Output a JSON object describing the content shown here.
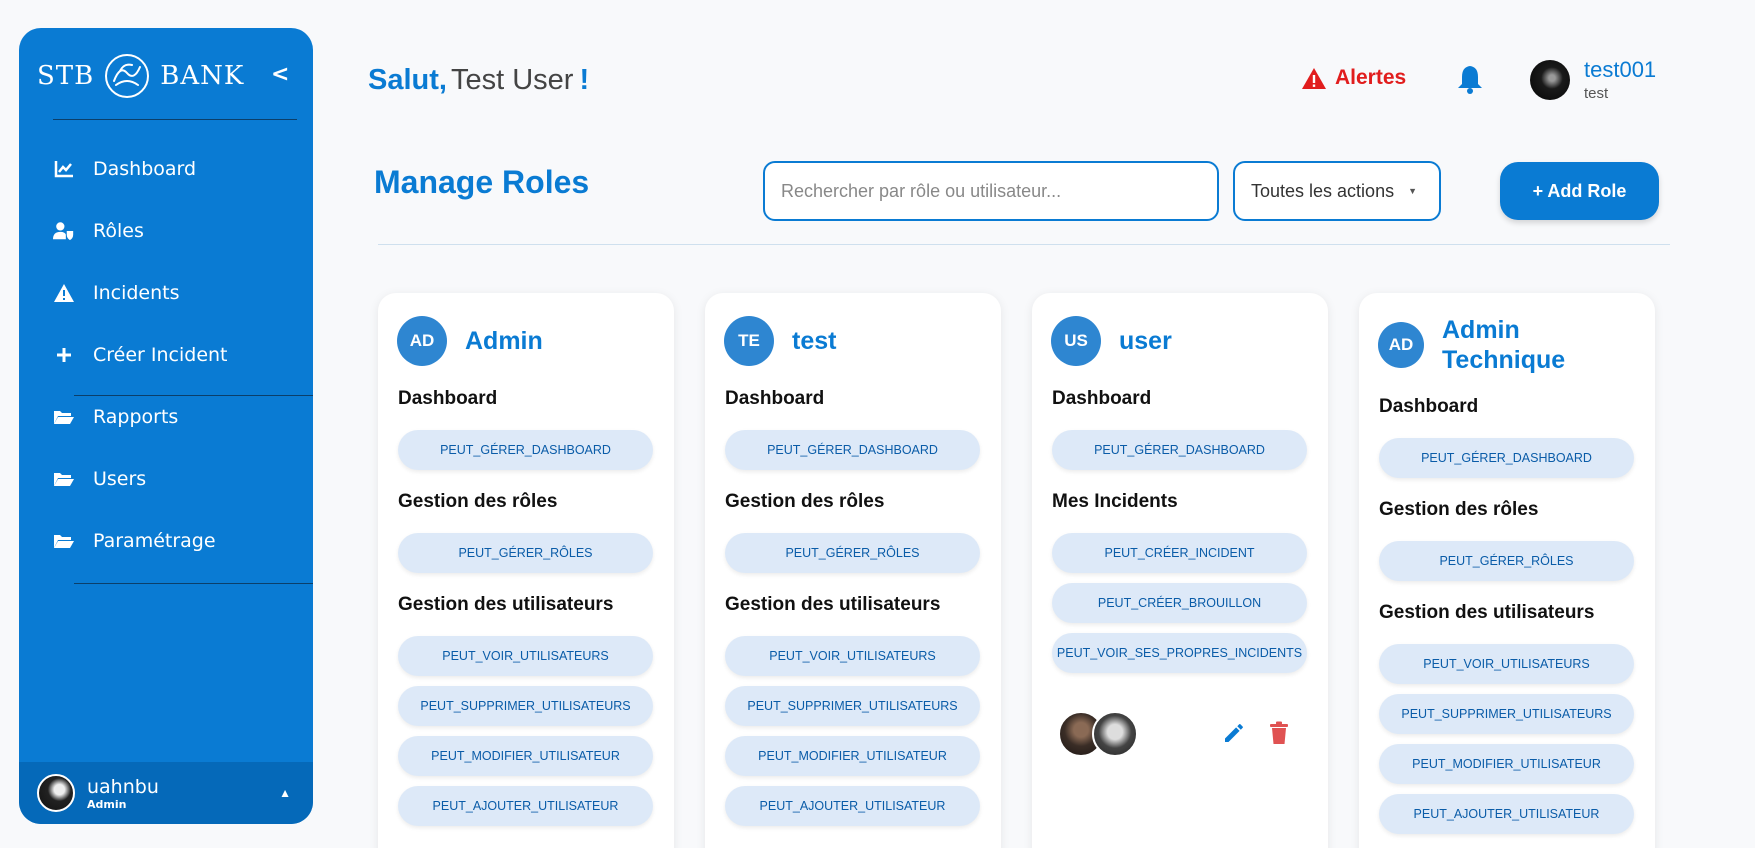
{
  "sidebar": {
    "brand_left": "STB",
    "brand_right": "BANK",
    "collapse": "<",
    "items": [
      {
        "label": "Dashboard",
        "icon": "chart-line-icon"
      },
      {
        "label": "Rôles",
        "icon": "user-shield-icon"
      },
      {
        "label": "Incidents",
        "icon": "warning-icon"
      },
      {
        "label": "Créer Incident",
        "icon": "plus-icon"
      },
      {
        "label": "Rapports",
        "icon": "folder-open-icon"
      },
      {
        "label": "Users",
        "icon": "folder-open-icon"
      },
      {
        "label": "Paramétrage",
        "icon": "folder-open-icon"
      }
    ],
    "user": {
      "name": "uahnbu",
      "role": "Admin"
    }
  },
  "header": {
    "greeting": "Salut,",
    "user_name": "Test User",
    "exclaim": "!",
    "alerts_label": "Alertes",
    "account": {
      "name": "test001",
      "sub": "test"
    }
  },
  "toolbar": {
    "title": "Manage Roles",
    "search_placeholder": "Rechercher par rôle ou utilisateur...",
    "filter_value": "Toutes les actions",
    "add_label": "+ Add Role"
  },
  "colors": {
    "primary": "#0a7bd3",
    "alert": "#e11d1d",
    "delete": "#e05252",
    "chip_bg": "#dde9f8"
  },
  "roles": [
    {
      "initials": "AD",
      "name": "Admin",
      "sections": [
        {
          "title": "Dashboard",
          "perms": [
            "PEUT_GÉRER_DASHBOARD"
          ]
        },
        {
          "title": "Gestion des rôles",
          "perms": [
            "PEUT_GÉRER_RÔLES"
          ]
        },
        {
          "title": "Gestion des utilisateurs",
          "perms": [
            "PEUT_VOIR_UTILISATEURS",
            "PEUT_SUPPRIMER_UTILISATEURS",
            "PEUT_MODIFIER_UTILISATEUR",
            "PEUT_AJOUTER_UTILISATEUR"
          ]
        }
      ]
    },
    {
      "initials": "TE",
      "name": "test",
      "sections": [
        {
          "title": "Dashboard",
          "perms": [
            "PEUT_GÉRER_DASHBOARD"
          ]
        },
        {
          "title": "Gestion des rôles",
          "perms": [
            "PEUT_GÉRER_RÔLES"
          ]
        },
        {
          "title": "Gestion des utilisateurs",
          "perms": [
            "PEUT_VOIR_UTILISATEURS",
            "PEUT_SUPPRIMER_UTILISATEURS",
            "PEUT_MODIFIER_UTILISATEUR",
            "PEUT_AJOUTER_UTILISATEUR"
          ]
        }
      ]
    },
    {
      "initials": "US",
      "name": "user",
      "sections": [
        {
          "title": "Dashboard",
          "perms": [
            "PEUT_GÉRER_DASHBOARD"
          ]
        },
        {
          "title": "Mes Incidents",
          "perms": [
            "PEUT_CRÉER_INCIDENT",
            "PEUT_CRÉER_BROUILLON",
            "PEUT_VOIR_SES_PROPRES_INCIDENTS"
          ]
        }
      ]
    },
    {
      "initials": "AD",
      "name": "Admin Technique",
      "sections": [
        {
          "title": "Dashboard",
          "perms": [
            "PEUT_GÉRER_DASHBOARD"
          ]
        },
        {
          "title": "Gestion des rôles",
          "perms": [
            "PEUT_GÉRER_RÔLES"
          ]
        },
        {
          "title": "Gestion des utilisateurs",
          "perms": [
            "PEUT_VOIR_UTILISATEURS",
            "PEUT_SUPPRIMER_UTILISATEURS",
            "PEUT_MODIFIER_UTILISATEUR",
            "PEUT_AJOUTER_UTILISATEUR"
          ]
        }
      ]
    }
  ]
}
